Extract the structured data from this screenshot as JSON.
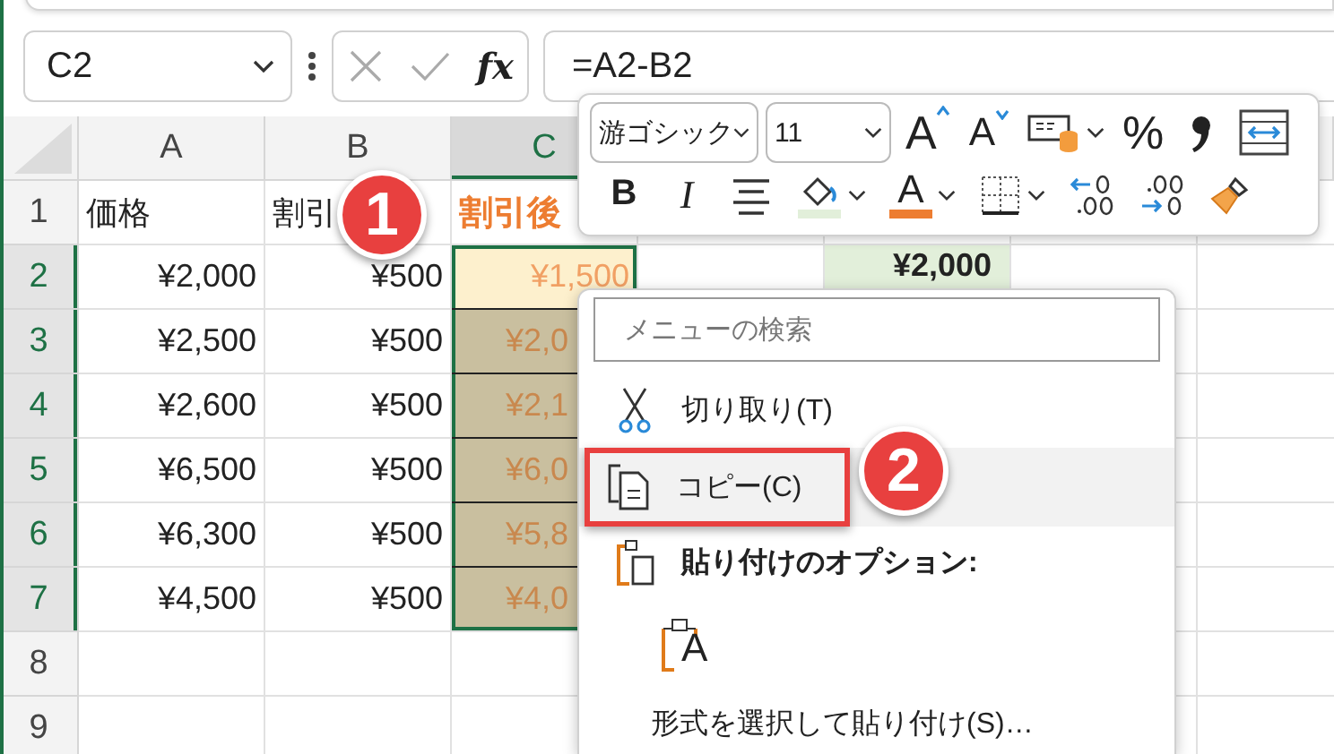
{
  "formula_bar": {
    "name_box": "C2",
    "fx": "fx",
    "formula": "=A2-B2"
  },
  "columns": [
    {
      "label": "A",
      "selected": false
    },
    {
      "label": "B",
      "selected": false
    },
    {
      "label": "C",
      "selected": true
    }
  ],
  "rows": [
    {
      "number": "1",
      "selected": false,
      "cells": [
        {
          "text": "価格",
          "kind": "text"
        },
        {
          "text": "割引",
          "kind": "text"
        },
        {
          "text": "割引後",
          "kind": "accent"
        }
      ]
    },
    {
      "number": "2",
      "selected": true,
      "cells": [
        {
          "text": "¥2,000",
          "kind": "number"
        },
        {
          "text": "¥500",
          "kind": "number"
        },
        {
          "text": "¥1,500",
          "kind": "active"
        },
        null,
        {
          "text": "¥2,000",
          "kind": "total"
        }
      ]
    },
    {
      "number": "3",
      "selected": true,
      "cells": [
        {
          "text": "¥2,500",
          "kind": "number"
        },
        {
          "text": "¥500",
          "kind": "number"
        },
        {
          "text": "¥2,0",
          "kind": "range"
        }
      ]
    },
    {
      "number": "4",
      "selected": true,
      "cells": [
        {
          "text": "¥2,600",
          "kind": "number"
        },
        {
          "text": "¥500",
          "kind": "number"
        },
        {
          "text": "¥2,1",
          "kind": "range"
        }
      ]
    },
    {
      "number": "5",
      "selected": true,
      "cells": [
        {
          "text": "¥6,500",
          "kind": "number"
        },
        {
          "text": "¥500",
          "kind": "number"
        },
        {
          "text": "¥6,0",
          "kind": "range"
        }
      ]
    },
    {
      "number": "6",
      "selected": true,
      "cells": [
        {
          "text": "¥6,300",
          "kind": "number"
        },
        {
          "text": "¥500",
          "kind": "number"
        },
        {
          "text": "¥5,8",
          "kind": "range"
        }
      ]
    },
    {
      "number": "7",
      "selected": true,
      "cells": [
        {
          "text": "¥4,500",
          "kind": "number"
        },
        {
          "text": "¥500",
          "kind": "number"
        },
        {
          "text": "¥4,0",
          "kind": "range"
        }
      ]
    },
    {
      "number": "8",
      "selected": false
    },
    {
      "number": "9",
      "selected": false
    }
  ],
  "mini_toolbar": {
    "font": "游ゴシック",
    "size": "11",
    "row_1": [
      {
        "kind": "grow-font",
        "label": "A"
      },
      {
        "kind": "shrink-font",
        "label": "A"
      },
      {
        "kind": "number-format"
      },
      {
        "kind": "percent",
        "label": "%"
      },
      {
        "kind": "comma"
      },
      {
        "kind": "wrap"
      }
    ],
    "row_2": [
      {
        "kind": "bold",
        "label": "B"
      },
      {
        "kind": "italic",
        "label": "I"
      },
      {
        "kind": "center"
      },
      {
        "kind": "fill-color"
      },
      {
        "kind": "font-color",
        "label": "A"
      },
      {
        "kind": "borders"
      },
      {
        "kind": "inc-decimal"
      },
      {
        "kind": "dec-decimal"
      },
      {
        "kind": "format-painter"
      }
    ]
  },
  "context_menu": {
    "search": {
      "placeholder": "メニューの検索"
    },
    "items": [
      {
        "kind": "cut",
        "label": "切り取り(T)",
        "hovered": false,
        "outlined": false
      },
      {
        "kind": "copy",
        "label": "コピー(C)",
        "hovered": true,
        "outlined": true
      },
      {
        "kind": "paste-header",
        "label": "貼り付けのオプション:",
        "hovered": false,
        "outlined": false
      },
      {
        "kind": "paste-option",
        "label": "A",
        "hovered": false,
        "outlined": false
      },
      {
        "kind": "command",
        "label": "形式を選択して貼り付け(S)…",
        "hovered": false,
        "outlined": false
      }
    ]
  },
  "callouts": [
    {
      "number": "1"
    },
    {
      "number": "2"
    }
  ]
}
